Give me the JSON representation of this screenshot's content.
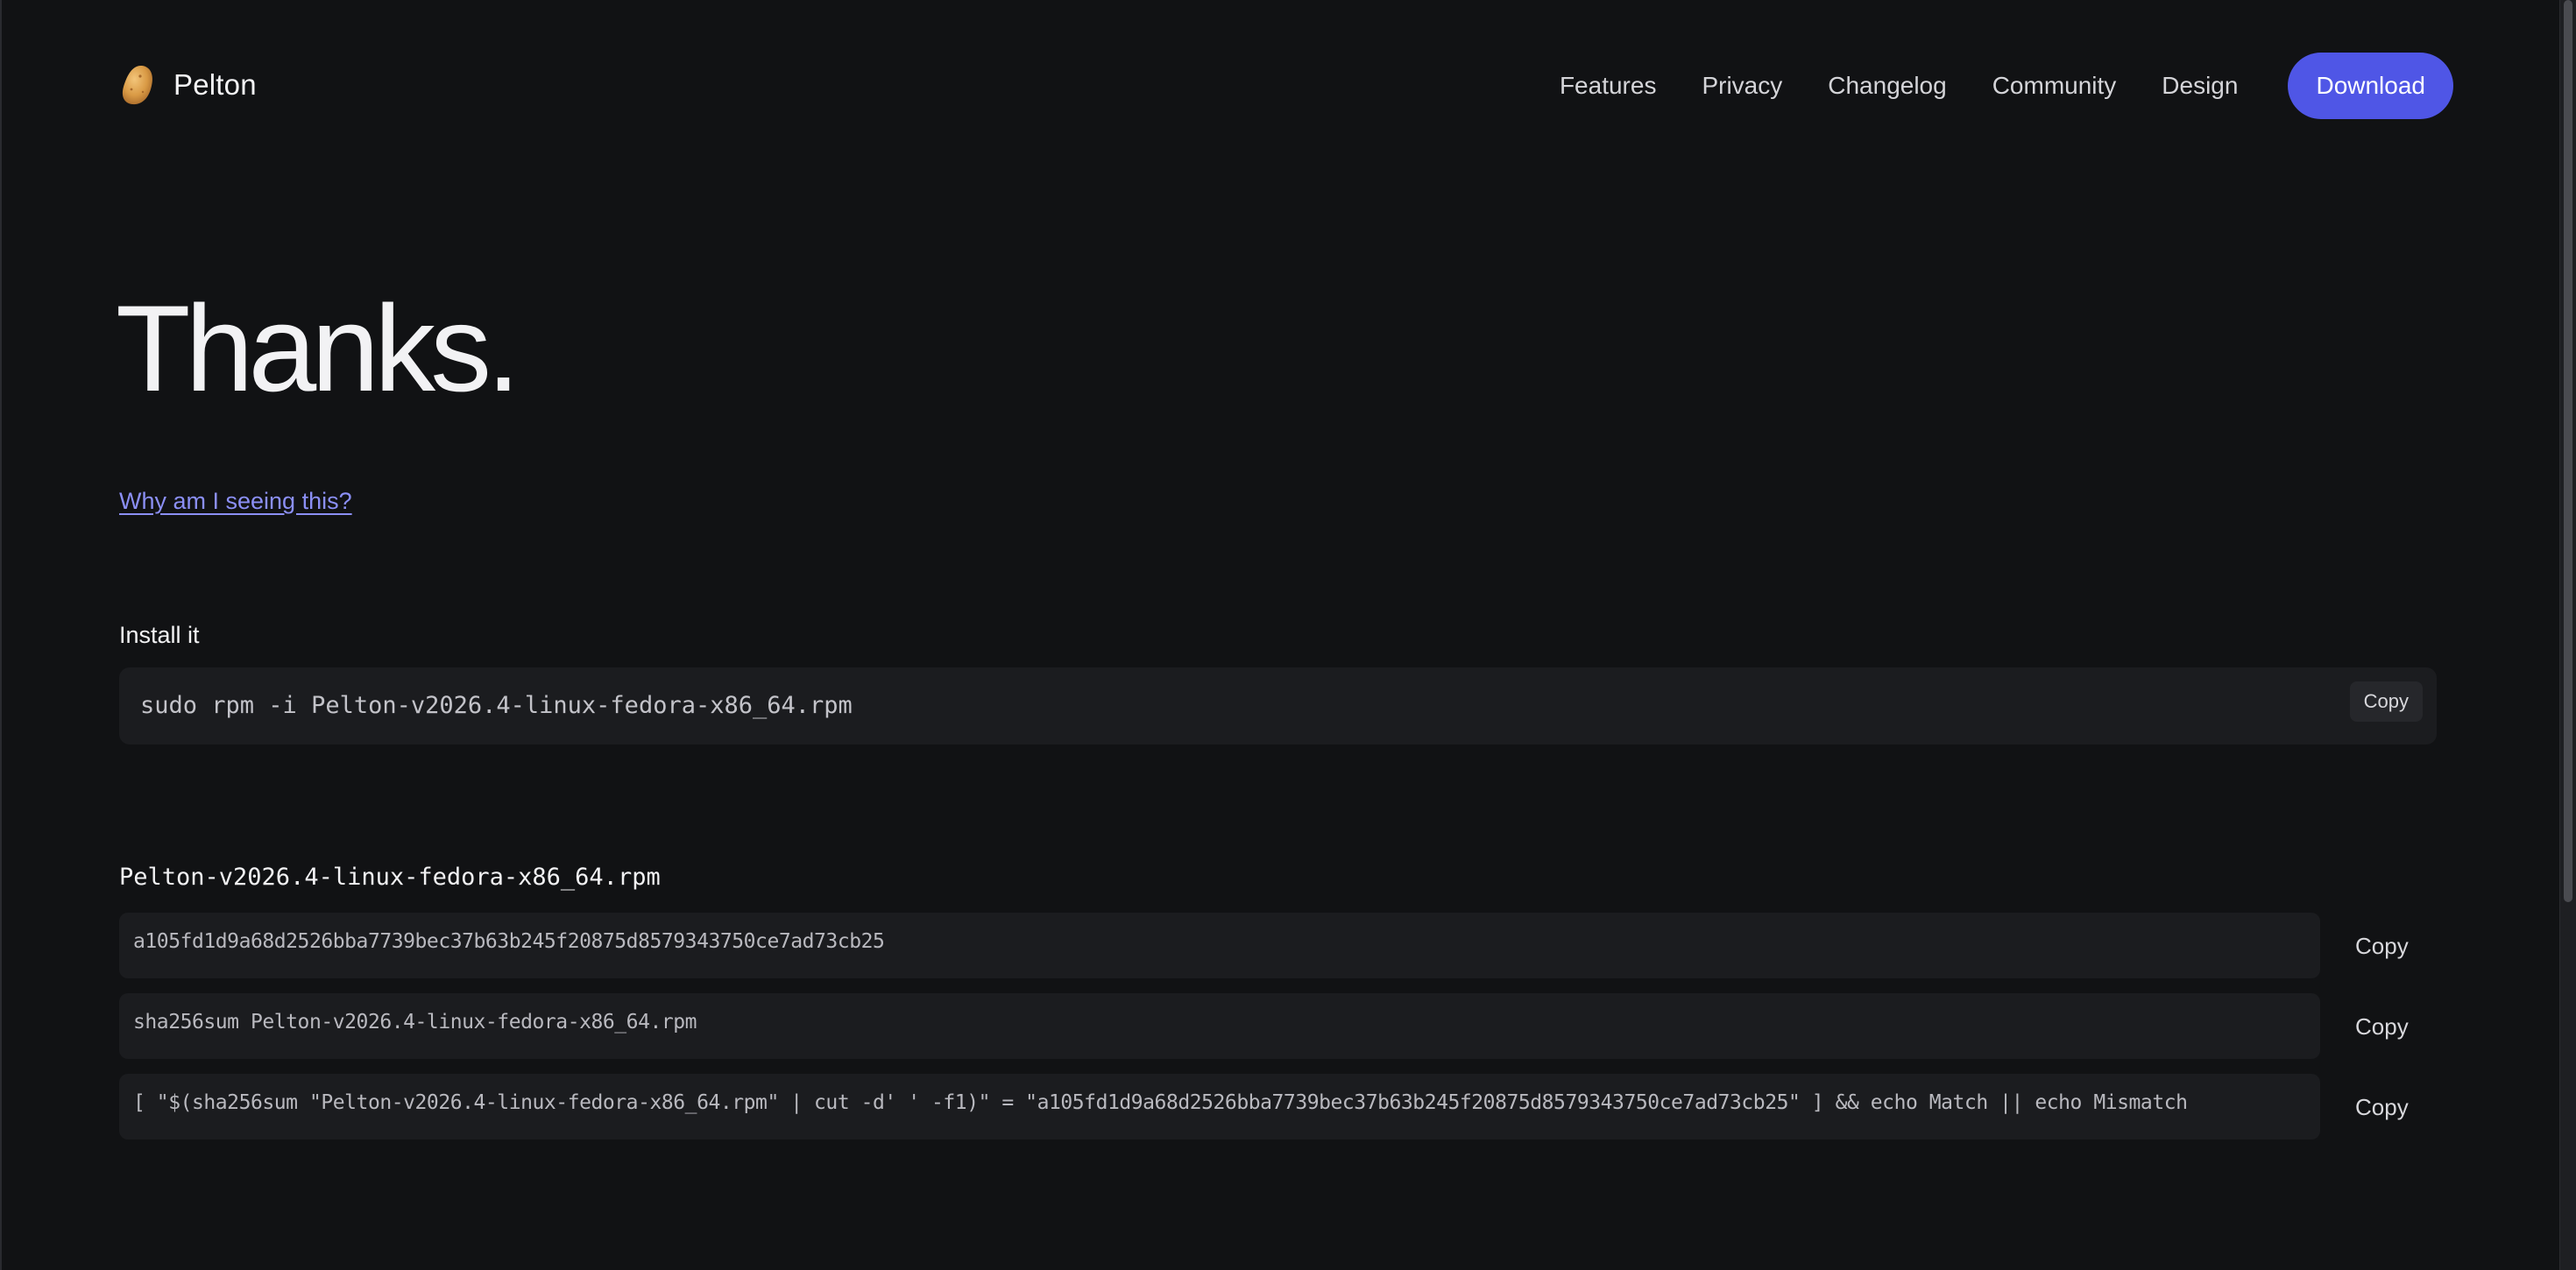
{
  "header": {
    "brand": "Pelton",
    "nav": [
      "Features",
      "Privacy",
      "Changelog",
      "Community",
      "Design"
    ],
    "download_label": "Download"
  },
  "hero": {
    "title": "Thanks.",
    "why_link": "Why am I seeing this?"
  },
  "install": {
    "label": "Install it",
    "command": "sudo rpm -i Pelton-v2026.4-linux-fedora-x86_64.rpm",
    "copy_label": "Copy"
  },
  "checksum": {
    "file_name": "Pelton-v2026.4-linux-fedora-x86_64.rpm",
    "rows": [
      {
        "text": "a105fd1d9a68d2526bba7739bec37b63b245f20875d8579343750ce7ad73cb25",
        "copy_label": "Copy"
      },
      {
        "text": "sha256sum Pelton-v2026.4-linux-fedora-x86_64.rpm",
        "copy_label": "Copy"
      },
      {
        "text": "[ \"$(sha256sum \"Pelton-v2026.4-linux-fedora-x86_64.rpm\" | cut -d' ' -f1)\" = \"a105fd1d9a68d2526bba7739bec37b63b245f20875d8579343750ce7ad73cb25\" ] && echo Match || echo Mismatch",
        "copy_label": "Copy"
      }
    ]
  },
  "colors": {
    "background": "#111214",
    "accent": "#4f56e6",
    "link": "#8b8ff5",
    "code_bg": "#1b1c1f"
  },
  "icons": {
    "logo": "potato-icon"
  }
}
